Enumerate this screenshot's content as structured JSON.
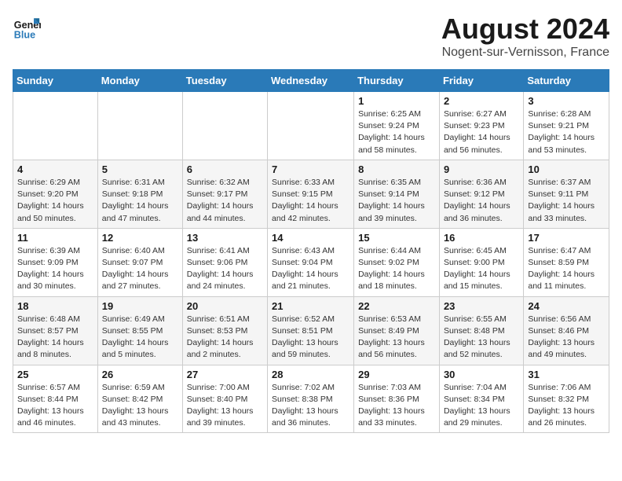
{
  "logo": {
    "text_general": "General",
    "text_blue": "Blue"
  },
  "header": {
    "month_year": "August 2024",
    "location": "Nogent-sur-Vernisson, France"
  },
  "weekdays": [
    "Sunday",
    "Monday",
    "Tuesday",
    "Wednesday",
    "Thursday",
    "Friday",
    "Saturday"
  ],
  "weeks": [
    [
      {
        "day": "",
        "info": ""
      },
      {
        "day": "",
        "info": ""
      },
      {
        "day": "",
        "info": ""
      },
      {
        "day": "",
        "info": ""
      },
      {
        "day": "1",
        "info": "Sunrise: 6:25 AM\nSunset: 9:24 PM\nDaylight: 14 hours\nand 58 minutes."
      },
      {
        "day": "2",
        "info": "Sunrise: 6:27 AM\nSunset: 9:23 PM\nDaylight: 14 hours\nand 56 minutes."
      },
      {
        "day": "3",
        "info": "Sunrise: 6:28 AM\nSunset: 9:21 PM\nDaylight: 14 hours\nand 53 minutes."
      }
    ],
    [
      {
        "day": "4",
        "info": "Sunrise: 6:29 AM\nSunset: 9:20 PM\nDaylight: 14 hours\nand 50 minutes."
      },
      {
        "day": "5",
        "info": "Sunrise: 6:31 AM\nSunset: 9:18 PM\nDaylight: 14 hours\nand 47 minutes."
      },
      {
        "day": "6",
        "info": "Sunrise: 6:32 AM\nSunset: 9:17 PM\nDaylight: 14 hours\nand 44 minutes."
      },
      {
        "day": "7",
        "info": "Sunrise: 6:33 AM\nSunset: 9:15 PM\nDaylight: 14 hours\nand 42 minutes."
      },
      {
        "day": "8",
        "info": "Sunrise: 6:35 AM\nSunset: 9:14 PM\nDaylight: 14 hours\nand 39 minutes."
      },
      {
        "day": "9",
        "info": "Sunrise: 6:36 AM\nSunset: 9:12 PM\nDaylight: 14 hours\nand 36 minutes."
      },
      {
        "day": "10",
        "info": "Sunrise: 6:37 AM\nSunset: 9:11 PM\nDaylight: 14 hours\nand 33 minutes."
      }
    ],
    [
      {
        "day": "11",
        "info": "Sunrise: 6:39 AM\nSunset: 9:09 PM\nDaylight: 14 hours\nand 30 minutes."
      },
      {
        "day": "12",
        "info": "Sunrise: 6:40 AM\nSunset: 9:07 PM\nDaylight: 14 hours\nand 27 minutes."
      },
      {
        "day": "13",
        "info": "Sunrise: 6:41 AM\nSunset: 9:06 PM\nDaylight: 14 hours\nand 24 minutes."
      },
      {
        "day": "14",
        "info": "Sunrise: 6:43 AM\nSunset: 9:04 PM\nDaylight: 14 hours\nand 21 minutes."
      },
      {
        "day": "15",
        "info": "Sunrise: 6:44 AM\nSunset: 9:02 PM\nDaylight: 14 hours\nand 18 minutes."
      },
      {
        "day": "16",
        "info": "Sunrise: 6:45 AM\nSunset: 9:00 PM\nDaylight: 14 hours\nand 15 minutes."
      },
      {
        "day": "17",
        "info": "Sunrise: 6:47 AM\nSunset: 8:59 PM\nDaylight: 14 hours\nand 11 minutes."
      }
    ],
    [
      {
        "day": "18",
        "info": "Sunrise: 6:48 AM\nSunset: 8:57 PM\nDaylight: 14 hours\nand 8 minutes."
      },
      {
        "day": "19",
        "info": "Sunrise: 6:49 AM\nSunset: 8:55 PM\nDaylight: 14 hours\nand 5 minutes."
      },
      {
        "day": "20",
        "info": "Sunrise: 6:51 AM\nSunset: 8:53 PM\nDaylight: 14 hours\nand 2 minutes."
      },
      {
        "day": "21",
        "info": "Sunrise: 6:52 AM\nSunset: 8:51 PM\nDaylight: 13 hours\nand 59 minutes."
      },
      {
        "day": "22",
        "info": "Sunrise: 6:53 AM\nSunset: 8:49 PM\nDaylight: 13 hours\nand 56 minutes."
      },
      {
        "day": "23",
        "info": "Sunrise: 6:55 AM\nSunset: 8:48 PM\nDaylight: 13 hours\nand 52 minutes."
      },
      {
        "day": "24",
        "info": "Sunrise: 6:56 AM\nSunset: 8:46 PM\nDaylight: 13 hours\nand 49 minutes."
      }
    ],
    [
      {
        "day": "25",
        "info": "Sunrise: 6:57 AM\nSunset: 8:44 PM\nDaylight: 13 hours\nand 46 minutes."
      },
      {
        "day": "26",
        "info": "Sunrise: 6:59 AM\nSunset: 8:42 PM\nDaylight: 13 hours\nand 43 minutes."
      },
      {
        "day": "27",
        "info": "Sunrise: 7:00 AM\nSunset: 8:40 PM\nDaylight: 13 hours\nand 39 minutes."
      },
      {
        "day": "28",
        "info": "Sunrise: 7:02 AM\nSunset: 8:38 PM\nDaylight: 13 hours\nand 36 minutes."
      },
      {
        "day": "29",
        "info": "Sunrise: 7:03 AM\nSunset: 8:36 PM\nDaylight: 13 hours\nand 33 minutes."
      },
      {
        "day": "30",
        "info": "Sunrise: 7:04 AM\nSunset: 8:34 PM\nDaylight: 13 hours\nand 29 minutes."
      },
      {
        "day": "31",
        "info": "Sunrise: 7:06 AM\nSunset: 8:32 PM\nDaylight: 13 hours\nand 26 minutes."
      }
    ]
  ]
}
